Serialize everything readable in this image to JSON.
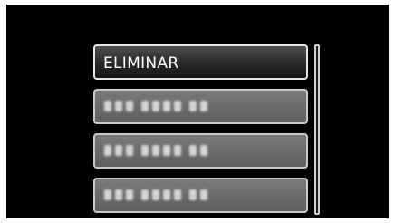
{
  "menu": {
    "items": [
      {
        "label": "ELIMINAR",
        "selected": true
      }
    ]
  }
}
